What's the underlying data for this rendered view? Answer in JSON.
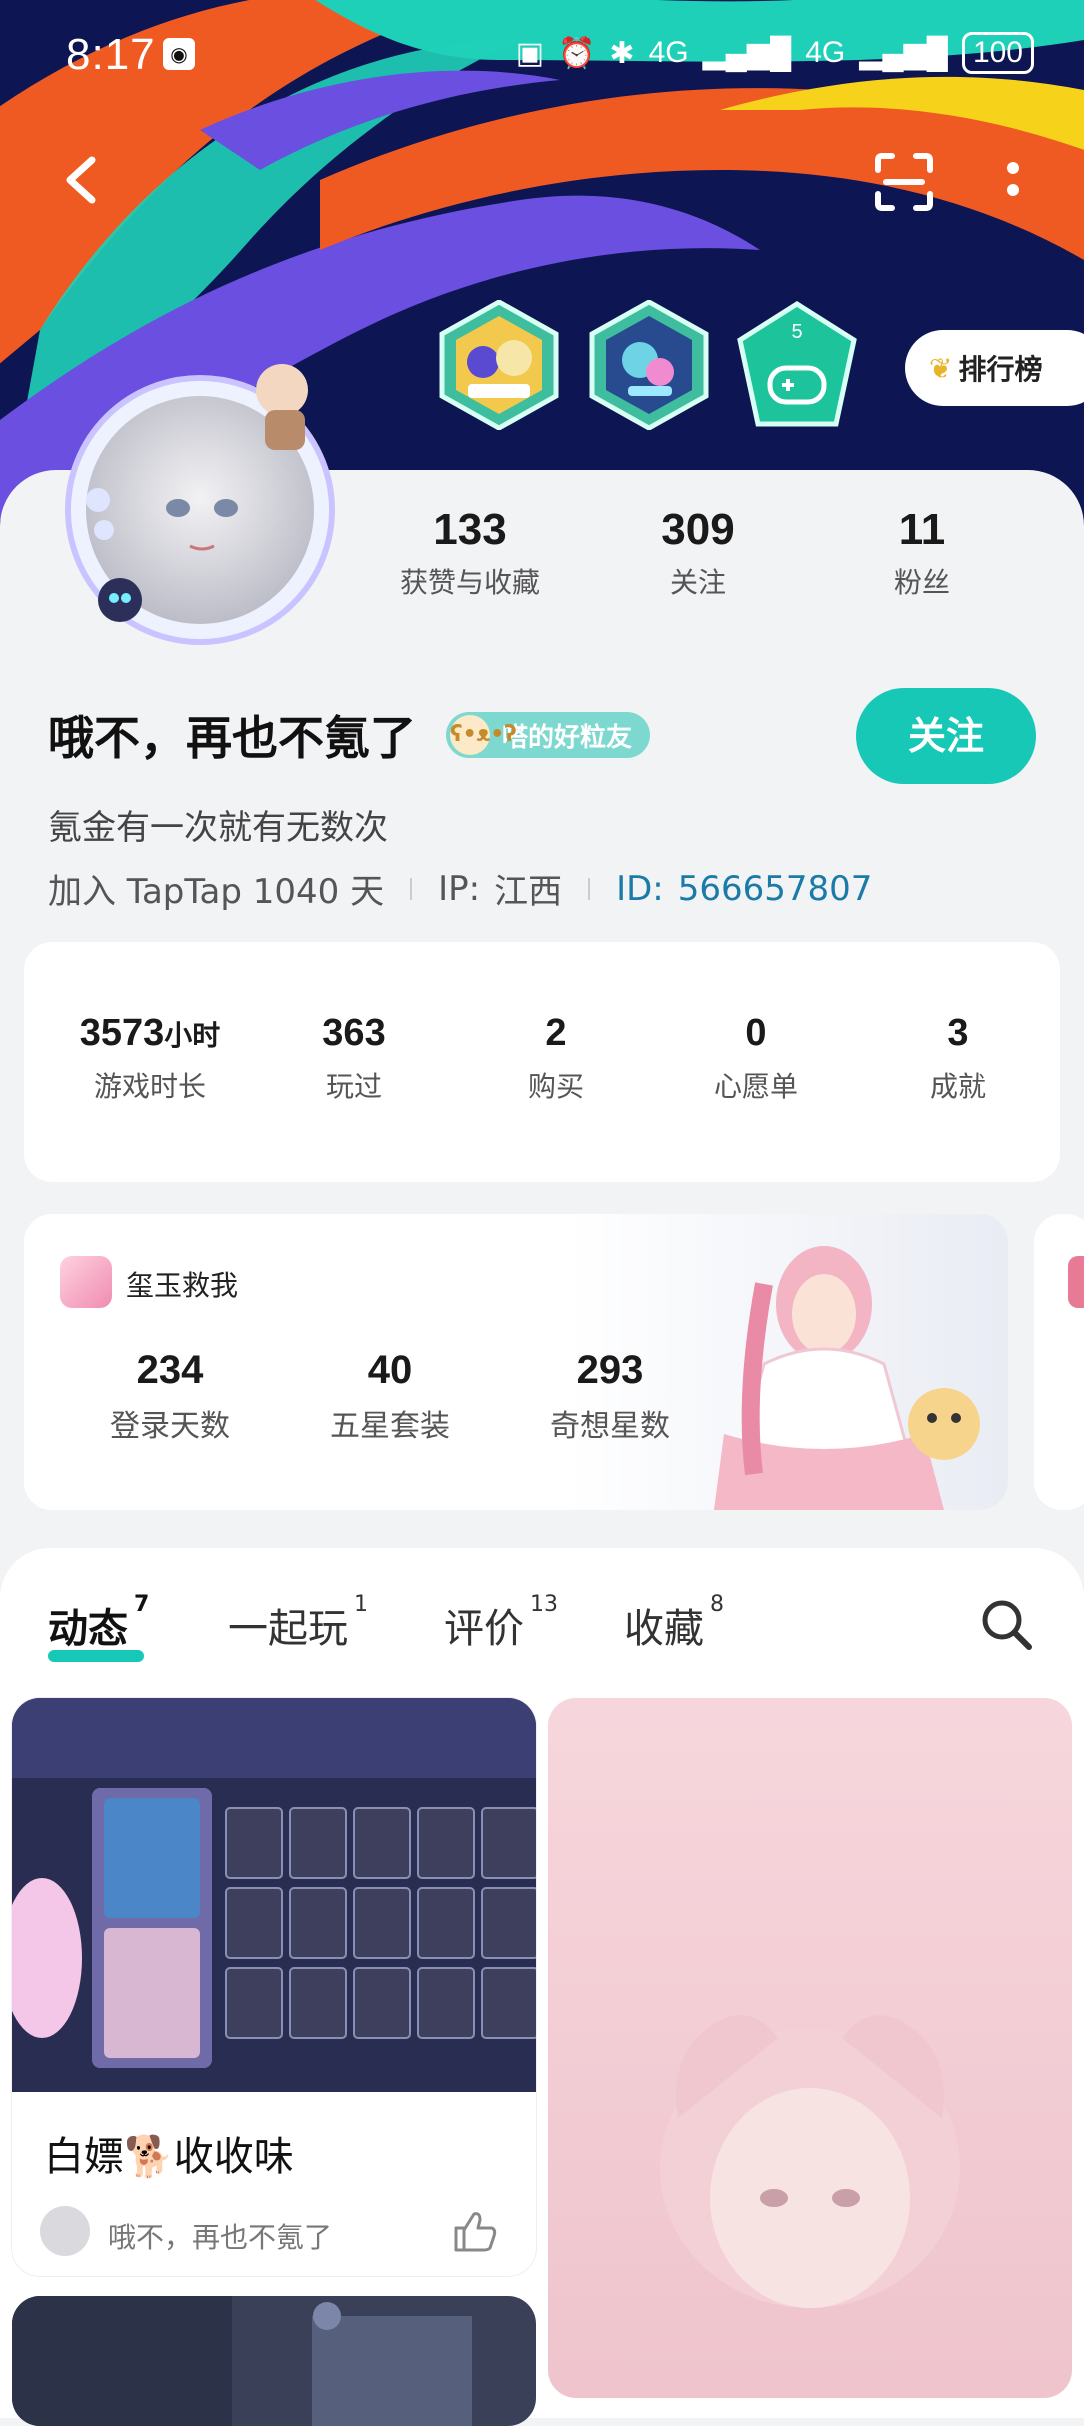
{
  "status_bar": {
    "time": "8:17",
    "network1": "4G",
    "network2": "4G",
    "battery": "100"
  },
  "header": {
    "back_icon": "chevron-left-icon",
    "scan_icon": "scan-icon",
    "more_icon": "more-vertical-icon",
    "ranking_label": "排行榜",
    "badge3_number": "5"
  },
  "profile": {
    "stats": [
      {
        "value": "133",
        "label": "获赞与收藏"
      },
      {
        "value": "309",
        "label": "关注"
      },
      {
        "value": "11",
        "label": "粉丝"
      }
    ],
    "name": "哦不，再也不氪了",
    "tag": "嗒的好粒友",
    "follow_label": "关注",
    "bio": "氪金有一次就有无数次",
    "join": "加入 TapTap 1040 天",
    "ip_label": "IP:",
    "ip_value": "江西",
    "id_label": "ID:",
    "id_value": "566657807"
  },
  "game_stats": [
    {
      "value": "3573",
      "unit": "小时",
      "label": "游戏时长"
    },
    {
      "value": "363",
      "label": "玩过"
    },
    {
      "value": "2",
      "label": "购买"
    },
    {
      "value": "0",
      "label": "心愿单"
    },
    {
      "value": "3",
      "label": "成就"
    }
  ],
  "game_card": {
    "name": "玺玉救我",
    "stats": [
      {
        "value": "234",
        "label": "登录天数"
      },
      {
        "value": "40",
        "label": "五星套装"
      },
      {
        "value": "293",
        "label": "奇想星数"
      }
    ]
  },
  "tabs": [
    {
      "label": "动态",
      "count": "7"
    },
    {
      "label": "一起玩",
      "count": "1"
    },
    {
      "label": "评价",
      "count": "13"
    },
    {
      "label": "收藏",
      "count": "8"
    }
  ],
  "posts": [
    {
      "title": "白嫖🐕收收味",
      "author": "哦不，再也不氪了"
    }
  ],
  "colors": {
    "accent": "#18c8b7",
    "id_link": "#1a7aa8"
  }
}
